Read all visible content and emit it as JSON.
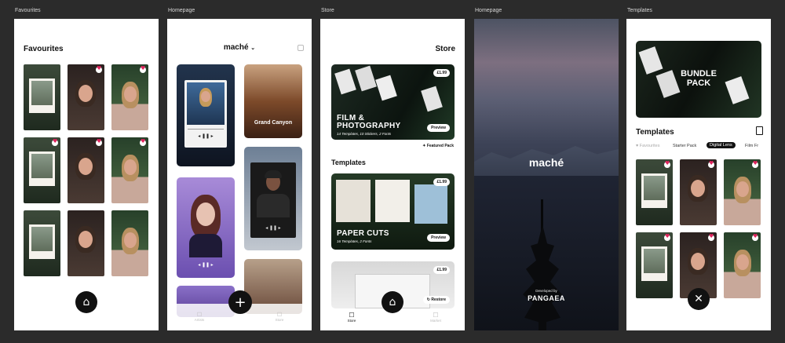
{
  "screens": {
    "favourites": {
      "frame_label": "Favourites",
      "title": "Favourites"
    },
    "homepage_feed": {
      "frame_label": "Homepage",
      "brand": "maché",
      "grand_canyon_label": "Grand Canyon",
      "tabs": [
        {
          "label": "Artists"
        },
        {
          "label": "Store"
        }
      ]
    },
    "store": {
      "frame_label": "Store",
      "title": "Store",
      "film_pack": {
        "price": "£1.99",
        "title_line1": "FILM &",
        "title_line2": "PHOTOGRAPHY",
        "subtitle": "14 Templates, 10 Stickers, 2 Fonts",
        "preview": "Preview",
        "featured": "Featured Pack"
      },
      "section_title": "Templates",
      "paper_cuts": {
        "price": "£1.99",
        "title": "PAPER CUTS",
        "subtitle": "16 Templates, 2 Fonts",
        "preview": "Preview"
      },
      "third_pack": {
        "price": "£1.99",
        "restore": "Restore"
      },
      "tabs": [
        {
          "label": "Store"
        },
        {
          "label": "Market"
        }
      ]
    },
    "homepage_splash": {
      "frame_label": "Homepage",
      "brand": "maché",
      "developed_by": "Developed by",
      "developer": "PANGAEA"
    },
    "templates": {
      "frame_label": "Templates",
      "bundle_line1": "BUNDLE",
      "bundle_line2": "PACK",
      "title": "Templates",
      "filters": [
        {
          "label": "♥ Favourites",
          "active": false
        },
        {
          "label": "Starter Pack",
          "active": false
        },
        {
          "label": "Digital Lens",
          "active": true
        },
        {
          "label": "Film Fr",
          "active": false
        }
      ]
    }
  },
  "colors": {
    "background": "#2b2b2b",
    "screen": "#ffffff",
    "accent_dark": "#111111",
    "heart": "#e0245e"
  }
}
